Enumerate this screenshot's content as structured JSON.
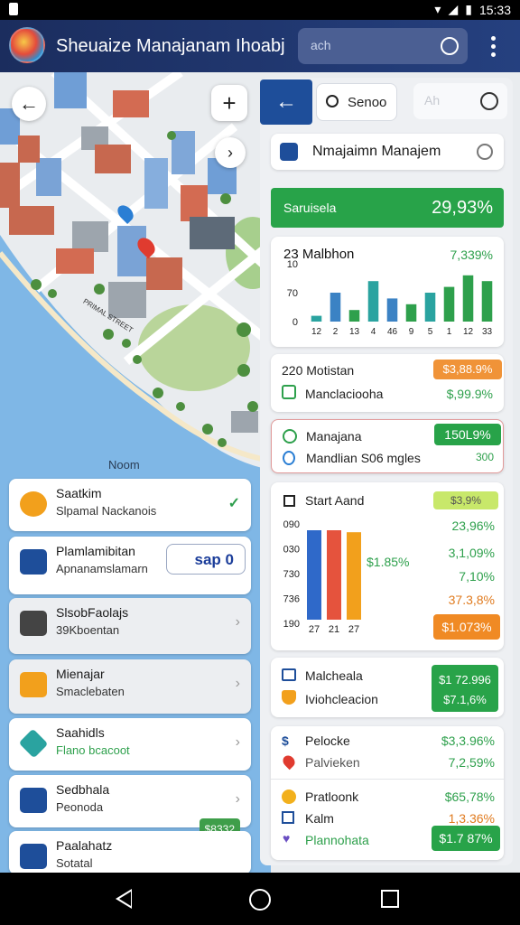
{
  "statusbar": {
    "time": "15:33"
  },
  "appbar": {
    "title": "Sheuaize Manajanam Ihoabj",
    "search_placeholder": "ach"
  },
  "map": {
    "label": "Noom",
    "street": "PRIMAL STREET"
  },
  "left_list": [
    {
      "title": "Saatkim",
      "subtitle": "Slpamal Nackanois",
      "trailing": "check",
      "icon_color": "#f2a01c"
    },
    {
      "title": "Plamlamibitan",
      "subtitle": "Apnanamslamarn",
      "trailing": "field",
      "field_value": "sap 0",
      "icon_color": "#1e4e9a"
    },
    {
      "title": "SlsobFaolajs",
      "subtitle": "39Kboentan",
      "trailing": "chevron",
      "icon_color": "#444"
    },
    {
      "title": "Mienajar",
      "subtitle": "Smaclebaten",
      "trailing": "chevron",
      "icon_color": "#f2a01c"
    },
    {
      "title": "Saahidls",
      "subtitle": "Flano bcacoot",
      "trailing": "chevron",
      "icon_color": "#2aa3a0"
    },
    {
      "title": "Sedbhala",
      "subtitle": "Peonoda",
      "trailing": "chevron",
      "badge": "$8332",
      "icon_color": "#1e4e9a"
    },
    {
      "title": "Paalahatz",
      "subtitle": "Sotatal",
      "trailing": "none",
      "icon_color": "#1e4e9a"
    }
  ],
  "panel": {
    "search_text": "Senoo",
    "faded_text": "Ah",
    "header_title": "Nmajaimn Manajem",
    "green_label": "Saruisela",
    "green_value": "29,93%",
    "chart1": {
      "title": "23 Malbhon",
      "value": "7,339%"
    },
    "row2": {
      "t1": "220 Motistan",
      "v1": "$3,88.9%",
      "t2": "Manclaciooha",
      "v2": "$,99.9%"
    },
    "row3": {
      "t1": "Manajana",
      "v1": "150L9%",
      "t2": "Mandlian S06 mgles",
      "v2": "300"
    },
    "chart2": {
      "title": "Start Aand",
      "values": [
        "$3,9%",
        "23,96%",
        "3,1,09%",
        "7,10%",
        "37.3,8%",
        "$1.073%"
      ],
      "inner_label": "$1.85%"
    },
    "pcard": {
      "t1": "Malcheala",
      "t2": "Iviohcleacion",
      "v1": "$1 72.996",
      "v2": "$7.1,6%"
    },
    "list": [
      {
        "label": "Pelocke",
        "value": "$3,3.96%"
      },
      {
        "label": "Palvieken",
        "value": "7,2,59%"
      },
      {
        "label": "Pratloonk",
        "value": "$65,78%"
      },
      {
        "label": "Kalm",
        "value": "1,3.36%"
      },
      {
        "label": "Plannohata",
        "value": "$1.7 87%"
      }
    ]
  },
  "chart_data": [
    {
      "type": "bar",
      "title": "23 Malbhon",
      "categories": [
        "12",
        "2",
        "13",
        "4",
        "46",
        "9",
        "5",
        "1",
        "12",
        "33"
      ],
      "series": [
        {
          "values": [
            1,
            5,
            2,
            7,
            4,
            3,
            5,
            6,
            8,
            7
          ]
        }
      ],
      "y_ticks": [
        "10",
        "70",
        "0"
      ],
      "ylim": [
        0,
        10
      ],
      "colors": [
        "#3b82c4",
        "#2aa3a0",
        "#2ea04c"
      ]
    },
    {
      "type": "bar",
      "title": "Start Aand",
      "categories": [
        "27",
        "21",
        "27"
      ],
      "series": [
        {
          "values": [
            90,
            90,
            88
          ]
        }
      ],
      "y_ticks": [
        "090",
        "030",
        "730",
        "736",
        "190"
      ],
      "ylim": [
        0,
        100
      ],
      "colors": [
        "#2f69c9",
        "#e5533d",
        "#f2a01c"
      ]
    }
  ]
}
